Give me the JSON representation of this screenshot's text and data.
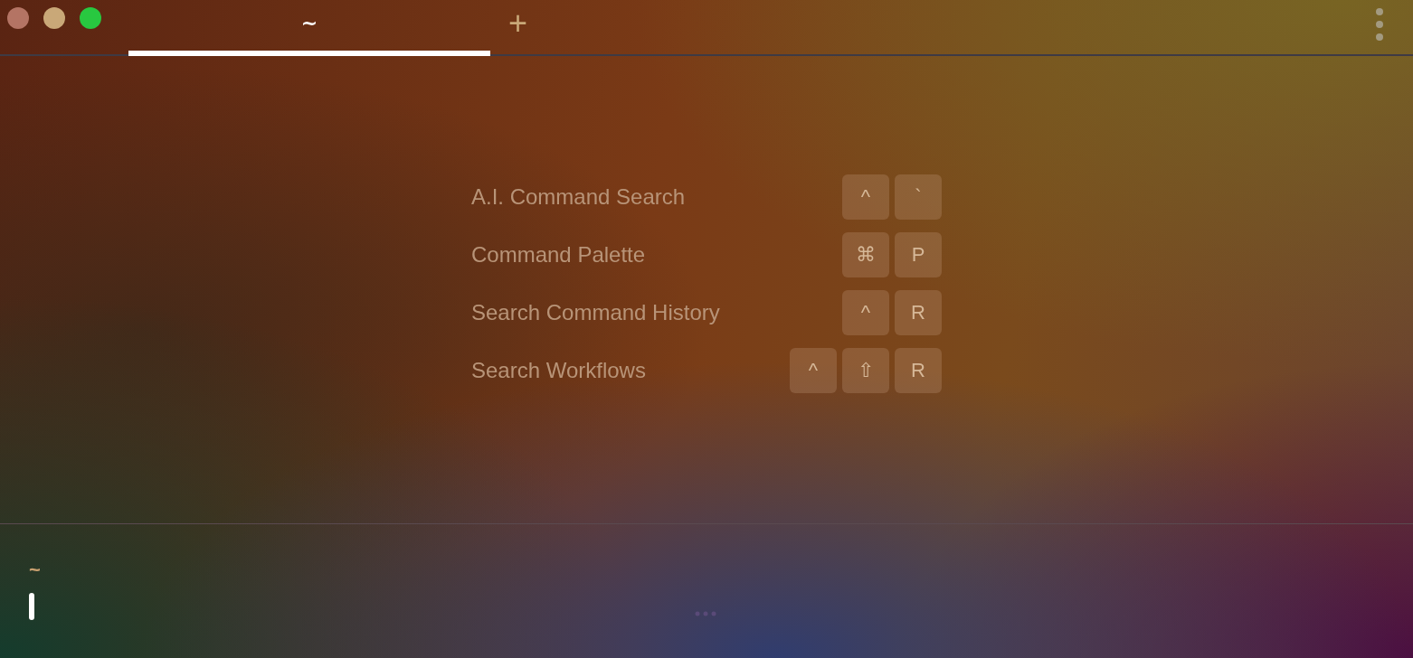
{
  "window": {
    "traffic_lights": [
      {
        "color": "#b47464"
      },
      {
        "color": "#c9a878"
      },
      {
        "color": "#28c840"
      }
    ]
  },
  "tabs": [
    {
      "label": "~",
      "selected": true
    }
  ],
  "new_tab": "+",
  "shortcuts": [
    {
      "label": "A.I. Command Search",
      "keys": [
        "^",
        "`"
      ]
    },
    {
      "label": "Command Palette",
      "keys": [
        "⌘",
        "P"
      ]
    },
    {
      "label": "Search Command History",
      "keys": [
        "^",
        "R"
      ]
    },
    {
      "label": "Search Workflows",
      "keys": [
        "^",
        "⇧",
        "R"
      ]
    }
  ],
  "prompt": {
    "directory": "~"
  }
}
